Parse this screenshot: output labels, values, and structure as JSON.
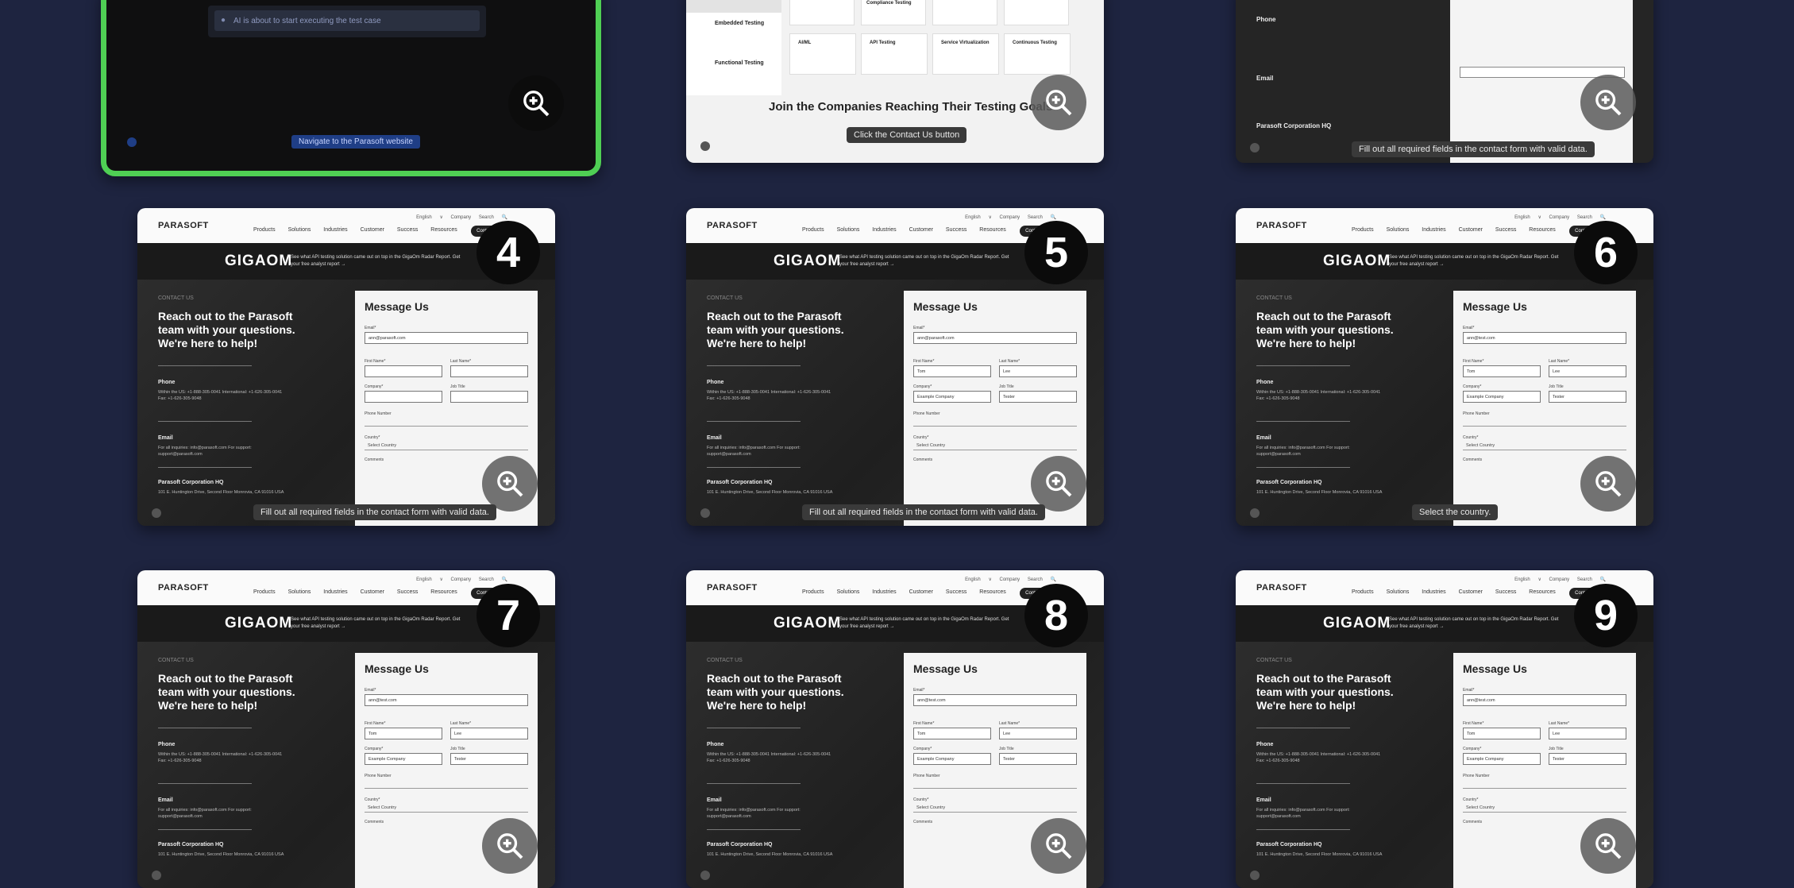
{
  "colors": {
    "background": "#1e2440",
    "active_border": "#4fcf54"
  },
  "site": {
    "logo": "PARASOFT",
    "nav_links": "Products Solutions Industries Customer Success Resources",
    "util_links": "English ∨ Company Search 🔍",
    "cta": "Contact Us",
    "promo_brand": "GIGAOM",
    "promo_text": "See what API testing solution came out on top in the GigaOm Radar Report. Get your free analyst report →"
  },
  "page": {
    "kicker": "CONTACT US",
    "headline": "Reach out to the Parasoft team with your questions. We're here to help!",
    "phone_title": "Phone",
    "phone_lines": "Within the US: +1-888-305-0041 International: +1-626-305-0041 Fax: +1-626-305-9048",
    "email_title": "Email",
    "email_lines": "For all inquiries: info@parasoft.com For support: support@parasoft.com",
    "hq_title": "Parasoft Corporation HQ",
    "hq_lines": "101 E. Huntington Drive, Second Floor Monrovia, CA 91016 USA",
    "form_title": "Message Us",
    "lbl_email": "Email*",
    "lbl_first": "First Name*",
    "lbl_last": "Last Name*",
    "lbl_company": "Company*",
    "lbl_title": "Job Title",
    "lbl_phone": "Phone Number",
    "lbl_country": "Country*",
    "lbl_comments": "Comments",
    "select_country": "Select Country"
  },
  "top_row": {
    "card1_status": "AI is about to start executing the test case",
    "card1_action": "Navigate to the Parasoft website",
    "card2_heading": "Join the Companies Reaching Their Testing Goals",
    "card2_tiles": [
      "Compliance Testing",
      "Embedded Testing",
      "Functional Testing",
      "AI/ML",
      "API Testing",
      "Service Virtualization",
      "Continuous Testing"
    ],
    "card2_tooltip": "Click the Contact Us button",
    "card3_phone": "Phone",
    "card3_email": "Email",
    "card3_hq": "Parasoft Corporation HQ",
    "card3_tooltip": "Fill out all required fields in the contact form with valid data."
  },
  "steps": [
    {
      "number": "4",
      "email": "ann@parasoft.com",
      "first": "",
      "last": "",
      "company": "",
      "title": "",
      "tooltip": "Fill out all required fields in the contact form with valid data."
    },
    {
      "number": "5",
      "email": "ann@parasoft.com",
      "first": "Tom",
      "last": "Lee",
      "company": "Example Company",
      "title": "Tester",
      "tooltip": "Fill out all required fields in the contact form with valid data."
    },
    {
      "number": "6",
      "email": "ann@test.com",
      "first": "Tom",
      "last": "Lee",
      "company": "Example Company",
      "title": "Tester",
      "tooltip": "Select the country."
    },
    {
      "number": "7",
      "email": "ann@test.com",
      "first": "Tom",
      "last": "Lee",
      "company": "Example Company",
      "title": "Tester",
      "tooltip": ""
    },
    {
      "number": "8",
      "email": "ann@test.com",
      "first": "Tom",
      "last": "Lee",
      "company": "Example Company",
      "title": "Tester",
      "tooltip": ""
    },
    {
      "number": "9",
      "email": "ann@test.com",
      "first": "Tom",
      "last": "Lee",
      "company": "Example Company",
      "title": "Tester",
      "tooltip": ""
    }
  ]
}
